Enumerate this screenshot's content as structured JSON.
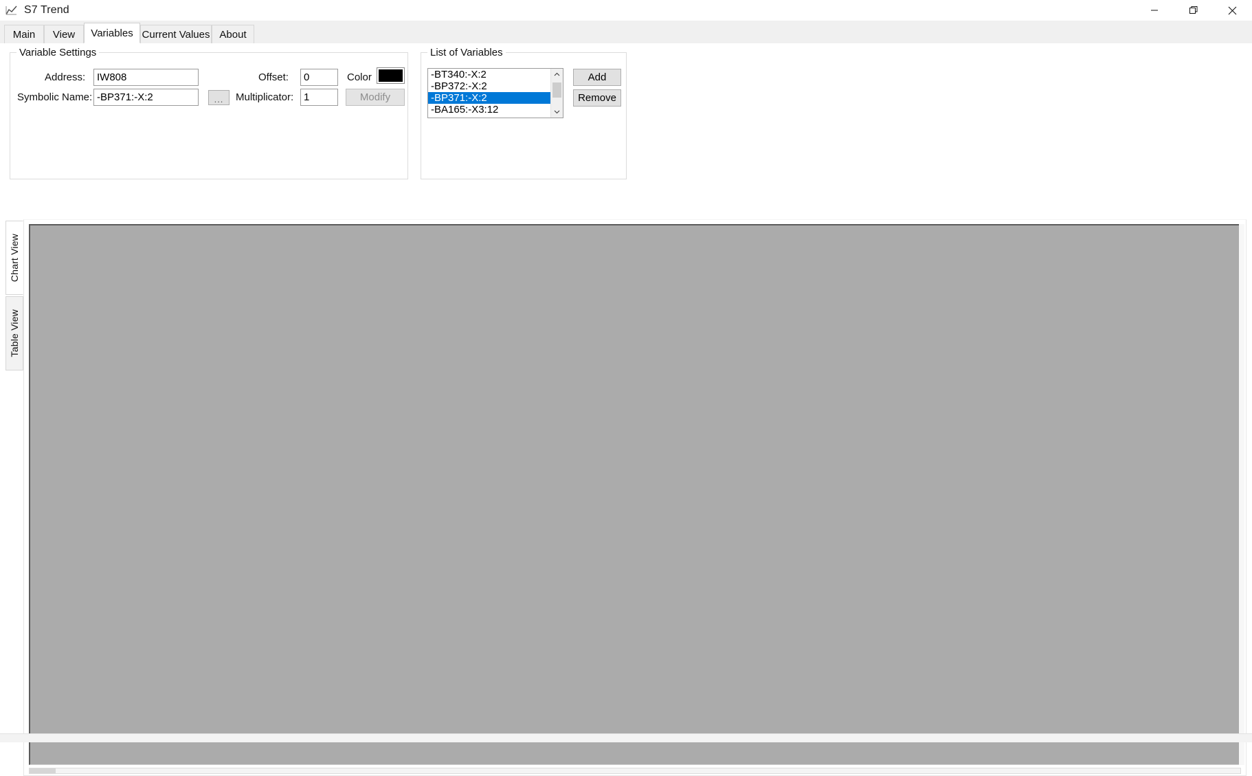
{
  "window": {
    "title": "S7 Trend",
    "icon": "trend-chart-icon",
    "controls": {
      "minimize": "minimize-icon",
      "maximize": "maximize-icon",
      "close": "close-icon"
    }
  },
  "tabs": [
    {
      "label": "Main",
      "active": false
    },
    {
      "label": "View",
      "active": false
    },
    {
      "label": "Variables",
      "active": true
    },
    {
      "label": "Current Values",
      "active": false
    },
    {
      "label": "About",
      "active": false
    }
  ],
  "variable_settings": {
    "title": "Variable Settings",
    "address_label": "Address:",
    "address_value": "IW808",
    "address_placeholder": "",
    "symbolic_name_label": "Symbolic Name:",
    "symbolic_name_value": "-BP371:-X:2",
    "symbolic_name_placeholder": "",
    "browse_button": "...",
    "offset_label": "Offset:",
    "offset_value": "0",
    "multiplicator_label": "Multiplicator:",
    "multiplicator_value": "1",
    "color_label": "Color",
    "color_value": "#000000",
    "modify_button": "Modify",
    "modify_enabled": false
  },
  "list_of_variables": {
    "title": "List of Variables",
    "items": [
      {
        "label": "-BT340:-X:2",
        "selected": false
      },
      {
        "label": "-BP372:-X:2",
        "selected": false
      },
      {
        "label": "-BP371:-X:2",
        "selected": true
      },
      {
        "label": "-BA165:-X3:12",
        "selected": false
      }
    ],
    "scroll_up": "chevron-up-icon",
    "scroll_down": "chevron-down-icon",
    "add_button": "Add",
    "remove_button": "Remove"
  },
  "side_tabs": [
    {
      "label": "Chart View",
      "active": true
    },
    {
      "label": "Table View",
      "active": false
    }
  ],
  "chart_area": {
    "background_color": "#ababab",
    "content": ""
  },
  "colors": {
    "accent": "#0078d7",
    "window_bg": "#ffffff",
    "tab_bg": "#f0f0f0",
    "canvas_gray": "#ababab"
  }
}
